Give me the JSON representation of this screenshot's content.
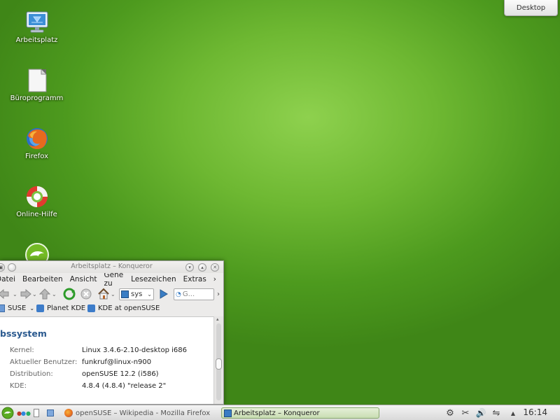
{
  "desktop": {
    "icons": [
      {
        "label": "Arbeitsplatz",
        "icon": "computer-monitor-icon"
      },
      {
        "label": "Büroprogramm",
        "icon": "document-icon"
      },
      {
        "label": "Firefox",
        "icon": "firefox-icon"
      },
      {
        "label": "Online-Hilfe",
        "icon": "lifebuoy-icon"
      },
      {
        "label": "",
        "icon": "opensuse-gecko-icon"
      }
    ],
    "desktop_button_label": "Desktop"
  },
  "window": {
    "title": "Arbeitsplatz – Konqueror",
    "menu": [
      "Datei",
      "Bearbeiten",
      "Ansicht",
      "Gehe zu",
      "Lesezeichen",
      "Extras"
    ],
    "location_text": "sys",
    "search_placeholder": "G...",
    "bookmarks": [
      "SUSE",
      "Planet KDE",
      "KDE at openSUSE"
    ],
    "heading": "bssystem",
    "info": [
      {
        "key": "Kernel:",
        "value": "Linux 3.4.6-2.10-desktop i686"
      },
      {
        "key": "Aktueller Benutzer:",
        "value": "funkruf@linux-n900"
      },
      {
        "key": "Distribution:",
        "value": "openSUSE 12.2 (i586)"
      },
      {
        "key": "KDE:",
        "value": "4.8.4 (4.8.4) \"release 2\""
      }
    ]
  },
  "taskbar": {
    "tasks": [
      {
        "label": "openSUSE – Wikipedia - Mozilla Firefox",
        "active": false
      },
      {
        "label": "Arbeitsplatz – Konqueror",
        "active": true
      }
    ],
    "clock": "16:14"
  },
  "colors": {
    "desktop_green": "#6eb832",
    "heading_blue": "#2b5a8f",
    "active_task": "#c8ddb2"
  }
}
